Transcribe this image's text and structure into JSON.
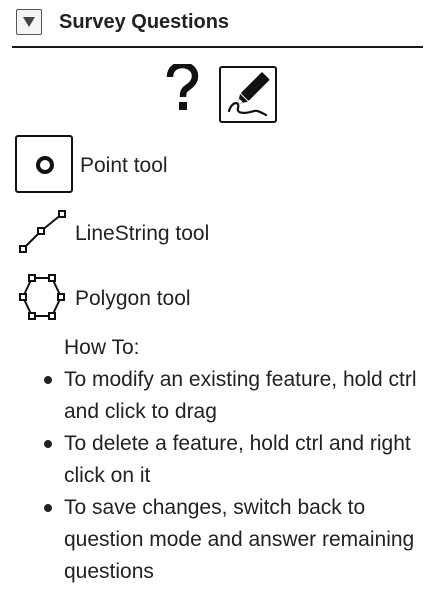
{
  "header": {
    "title": "Survey Questions",
    "collapse_icon": "triangle-down-icon"
  },
  "toolbar": {
    "help_icon": "question-mark-icon",
    "edit_icon": "pen-signature-icon"
  },
  "tools": [
    {
      "label": "Point tool",
      "icon": "point-circle-icon"
    },
    {
      "label": "LineString tool",
      "icon": "linestring-icon"
    },
    {
      "label": "Polygon tool",
      "icon": "polygon-icon"
    }
  ],
  "howto": {
    "title": "How To:",
    "items": [
      "To modify an existing feature, hold ctrl and click to drag",
      "To delete a feature, hold ctrl and right click on it",
      "To save changes, switch back to question mode and answer remaining questions"
    ]
  },
  "colors": {
    "text": "#222222",
    "border": "#111111",
    "button_bg": "#f4f4f4"
  }
}
